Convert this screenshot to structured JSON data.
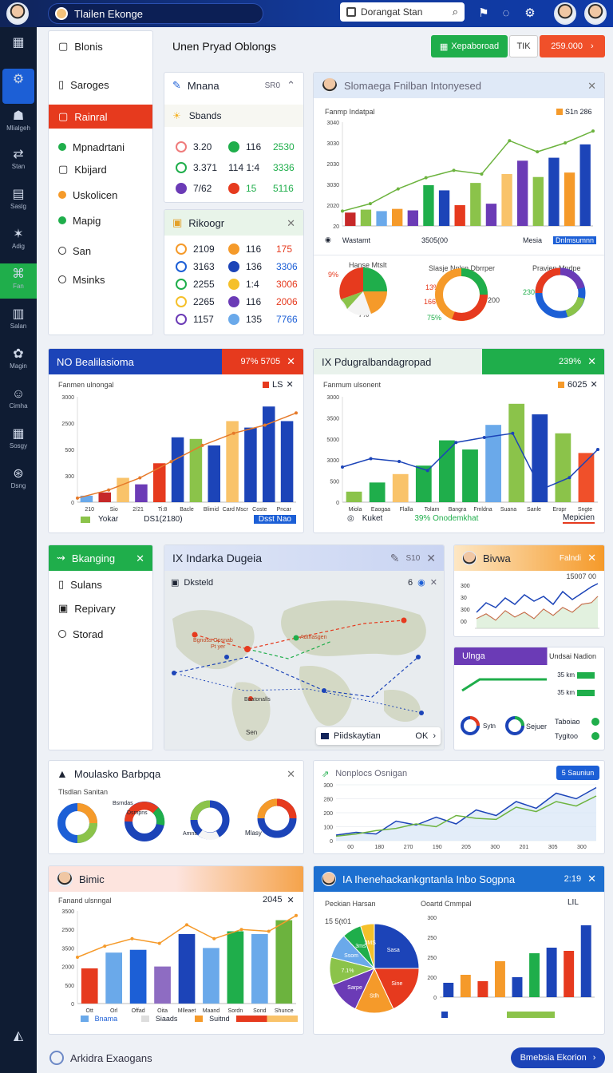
{
  "app": {
    "title": "Tlailen Ekonge",
    "search_value": "Dorangat Stan",
    "main_title": "Unen Pryad Oblongs"
  },
  "rail": [
    {
      "glyph": "▦",
      "label": ""
    },
    {
      "glyph": "⚙",
      "label": ""
    },
    {
      "glyph": "☗",
      "label": "Mlialgeh"
    },
    {
      "glyph": "⇄",
      "label": "Stan"
    },
    {
      "glyph": "▤",
      "label": "Saslg"
    },
    {
      "glyph": "✶",
      "label": "Adig"
    },
    {
      "glyph": "⌘",
      "label": "Fan"
    },
    {
      "glyph": "▥",
      "label": "Salan"
    },
    {
      "glyph": "✿",
      "label": "Magin"
    },
    {
      "glyph": "☺",
      "label": "Cimha"
    },
    {
      "glyph": "▦",
      "label": "Sosgy"
    },
    {
      "glyph": "⊛",
      "label": "Dsng"
    },
    {
      "glyph": "◭",
      "label": ""
    }
  ],
  "nav": {
    "items": [
      "Blonis",
      "Saroges",
      "Rainral",
      "Mpnadrtani",
      "Kbijard",
      "Uskolicen",
      "Mapig",
      "San",
      "Msinks"
    ]
  },
  "header_buttons": {
    "green": "Xepaboroad",
    "plain": "TIK",
    "red": "259.000"
  },
  "mana_panel": {
    "title": "Mnana",
    "header_right": "SR0",
    "sub": "Sbands",
    "rows": [
      {
        "a": "3.20",
        "b": "116",
        "c": "2530"
      },
      {
        "a": "3.371",
        "b": "114  1:4",
        "c": "3336"
      },
      {
        "a": "7/62",
        "b": "15",
        "c": "5116"
      }
    ]
  },
  "rikoogr_panel": {
    "title": "Rikoogr",
    "rows": [
      {
        "a": "2109",
        "b": "116",
        "c": "175"
      },
      {
        "a": "3163",
        "b": "136",
        "c": "3306"
      },
      {
        "a": "2255",
        "b": "1:4",
        "c": "3006"
      },
      {
        "a": "2265",
        "b": "116",
        "c": "2006"
      },
      {
        "a": "1157",
        "b": "135",
        "c": "7766"
      }
    ]
  },
  "overview_panel": {
    "title": "Slomaega Fnilban Intonyesed",
    "chart_label": "Fanmp Indatpal",
    "badge": "S1n 286",
    "legend_left": "Wastamt",
    "legend_mid": "3505(00",
    "legend_right1": "Mesia",
    "legend_right2": "Dnlmsumnn",
    "donut1_title": "Hanse Mtslt",
    "donut1_lbl": "9%",
    "donut1_lbl2": "7%",
    "donut2_title": "Slasje Nnlsn Dbrrper",
    "donut2_l1": "13%",
    "donut2_l2": "166",
    "donut2_l3": "75%",
    "donut2_r": "200",
    "donut3_title": "Pravien Mndpe",
    "donut3_l": "230"
  },
  "bar_panel_a": {
    "title": "NO Bealilasioma",
    "badge": "97% 5705",
    "chart_label": "Fanmen ulnongal",
    "legend_badge": "LS",
    "yticks": [
      "3000",
      "2500",
      "500",
      "300",
      "0"
    ],
    "xticks": [
      "210",
      "Sio",
      "2/21",
      "Ti:8",
      "Bacle",
      "Blimid",
      "Card Mscr",
      "Coste",
      "Pncar"
    ],
    "foot_left": "Yokar",
    "foot_mid": "DS1(2180)",
    "foot_right": "Dsst Nao"
  },
  "bar_panel_b": {
    "title": "IX Pdugralbandagropad",
    "badge": "239%",
    "chart_label": "Fanmum ulsonent",
    "legend_badge": "6025",
    "yticks": [
      "3000",
      "3500",
      "5000",
      "3000",
      "500",
      "0"
    ],
    "xticks": [
      "Miola",
      "Eaogaa",
      "Flalla",
      "Tolam",
      "Bangra",
      "Fmldna",
      "Suana",
      "Sanle",
      "Eropr",
      "Sngte"
    ],
    "foot_left": "Kuket",
    "foot_mid": "39% Onodemkhat",
    "foot_right": "Mepicien"
  },
  "bkanging_panel": {
    "title": "Bkanging",
    "items": [
      "Sulans",
      "Repivary",
      "Storad"
    ]
  },
  "map_panel": {
    "title": "IX Indarka Dugeia",
    "badge": "S10",
    "sub": "Dksteld",
    "sub_right": "6",
    "pill_left": "Piidskaytian",
    "pill_right": "OK",
    "labels": [
      "Bgnoss Opsnab",
      "Adthasgen",
      "Pt yer",
      "Baatonalls",
      "Sen"
    ]
  },
  "bivwa_panel": {
    "title": "Bivwa",
    "badge": "Falndi",
    "sub": "15007 00",
    "yticks": [
      "300",
      "30",
      "300",
      "00"
    ]
  },
  "ulnga_panel": {
    "title": "Ulnga",
    "right": "Undsai Nadion",
    "v1": "35 km",
    "v2": "35 km",
    "l1": "Sytn",
    "l2": "Sejuer",
    "r1": "Taboiao",
    "r2": "Tygitoo"
  },
  "donut_panel": {
    "title": "Moulasko Barbpqa",
    "sub": "Tlsdlan Sanitan",
    "labels": [
      "Bsrndas",
      "Dsmpns",
      "Amns",
      "Mlasy"
    ]
  },
  "line_panel": {
    "title": "Nonplocs Osnigan",
    "button": "5 Sauniun",
    "yticks": [
      "300",
      "280",
      "200",
      "100",
      "0"
    ],
    "xticks": [
      "00",
      "180",
      "270",
      "190",
      "205",
      "300",
      "201",
      "305",
      "300"
    ]
  },
  "bimic_panel": {
    "title": "Bimic",
    "chart_label": "Fanand ulsnngal",
    "badge": "2045",
    "yticks": [
      "3500",
      "2500",
      "3500",
      "2000",
      "500",
      "0"
    ],
    "xticks": [
      "Ott",
      "Orl",
      "Offad",
      "Oita",
      "Mlleaet",
      "Maand",
      "Sordn",
      "Sond",
      "Shunce"
    ],
    "foot_left": "Bnama",
    "foot_mid": "Siaads",
    "foot_right": "Suitnd"
  },
  "pie_panel": {
    "title": "IA Ihenehackankgntanla Inbo Sogpna",
    "badge": "2:19",
    "left_title": "Peckian Harsan",
    "left_val": "15 5(t01",
    "right_title": "Ooartd Cmmpal",
    "right_badge": "LIL",
    "slices": [
      "Sasa",
      "Sine",
      "Stlh",
      "Sarpe",
      "7.1%",
      "Ssom",
      "3ms",
      "3MS",
      "7.5%"
    ],
    "yticks": [
      "300",
      "250",
      "250",
      "200",
      "0"
    ]
  },
  "bottom": {
    "left_text": "Arkidra Exaogans",
    "button": "Bmebsia Ekorion"
  },
  "chart_data": [
    {
      "type": "bar",
      "title": "Slomaega Fnilban Intonyesed",
      "series": [
        {
          "name": "bars",
          "values": [
            18,
            22,
            20,
            23,
            21,
            55,
            48,
            28,
            58,
            30,
            70,
            88,
            66,
            92,
            72,
            110
          ]
        }
      ],
      "line": [
        20,
        30,
        50,
        65,
        75,
        70,
        115,
        100,
        112,
        128
      ],
      "ylim": [
        0,
        140
      ]
    },
    {
      "type": "bar",
      "title": "NO Bealilasioma",
      "values": [
        8,
        12,
        30,
        22,
        48,
        80,
        78,
        70,
        100,
        92,
        118,
        100
      ],
      "line": [
        5,
        15,
        30,
        50,
        70,
        85,
        95,
        110
      ],
      "ylim": [
        0,
        130
      ]
    },
    {
      "type": "bar",
      "title": "IX Pdugralbandagropad",
      "values": [
        15,
        28,
        40,
        52,
        88,
        75,
        110,
        140,
        125,
        98,
        70
      ],
      "line": [
        50,
        62,
        58,
        45,
        85,
        92,
        98,
        18,
        35,
        75
      ],
      "ylim": [
        0,
        150
      ]
    },
    {
      "type": "line",
      "title": "Nonplocs Osnigan",
      "series": [
        {
          "name": "a",
          "values": [
            10,
            15,
            12,
            35,
            28,
            42,
            30,
            55,
            45,
            70,
            58,
            85,
            75,
            95
          ]
        },
        {
          "name": "b",
          "values": [
            8,
            12,
            18,
            22,
            30,
            25,
            45,
            40,
            38,
            60,
            52,
            70,
            62,
            80
          ]
        }
      ],
      "ylim": [
        0,
        100
      ]
    },
    {
      "type": "bar",
      "title": "Bimic",
      "values": [
        38,
        55,
        58,
        40,
        75,
        60,
        78,
        75,
        90
      ],
      "line": [
        50,
        62,
        70,
        65,
        85,
        70,
        80,
        78,
        95
      ],
      "ylim": [
        0,
        100
      ]
    },
    {
      "type": "pie",
      "title": "Peckian Harsan",
      "values": [
        25,
        18,
        14,
        12,
        10,
        9,
        7,
        5
      ]
    }
  ],
  "colors": {
    "accent_blue": "#1c5fd6",
    "accent_green": "#1fae4b",
    "accent_red": "#e63a1e",
    "accent_orange": "#f59a2a",
    "accent_purple": "#6b3bb6"
  }
}
